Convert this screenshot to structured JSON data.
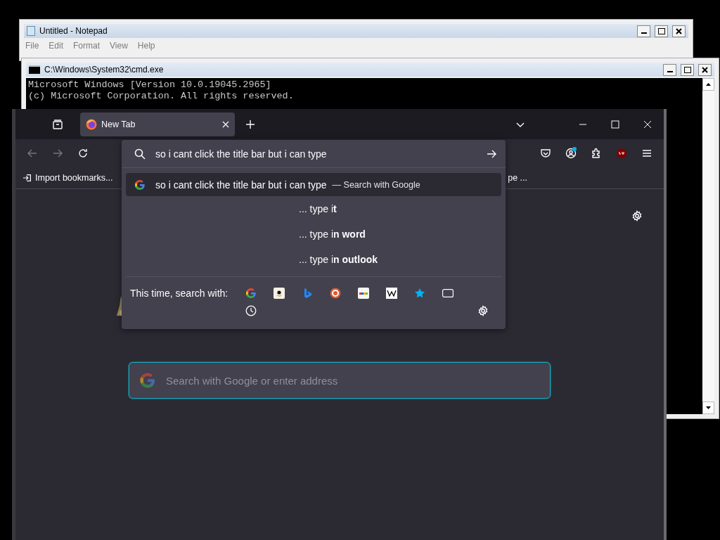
{
  "notepad": {
    "title": "Untitled - Notepad",
    "menu": [
      "File",
      "Edit",
      "Format",
      "View",
      "Help"
    ]
  },
  "cmd": {
    "title": "C:\\Windows\\System32\\cmd.exe",
    "lines": [
      "Microsoft Windows [Version 10.0.19045.2965]",
      "(c) Microsoft Corporation. All rights reserved."
    ]
  },
  "browser": {
    "tabs": [
      {
        "label": "New Tab",
        "selected": true
      }
    ],
    "bookmarks": [
      {
        "label": "Import bookmarks..."
      },
      {
        "label": "pe ..."
      }
    ],
    "urlbar": {
      "value": "so i cant click the title bar but i can type"
    },
    "suggestions": [
      {
        "kind": "search",
        "text": "so i cant click the title bar but i can type",
        "action": "— Search with Google",
        "selected": true
      },
      {
        "kind": "tail",
        "text": "... type i**t**",
        "selected": false
      },
      {
        "kind": "tail",
        "text": "... type i**n word**",
        "selected": false
      },
      {
        "kind": "tail",
        "text": "... type i**n outlook**",
        "selected": false
      }
    ],
    "search_with": "This time, search with:",
    "page_search": {
      "placeholder": "Search with Google or enter address"
    }
  }
}
